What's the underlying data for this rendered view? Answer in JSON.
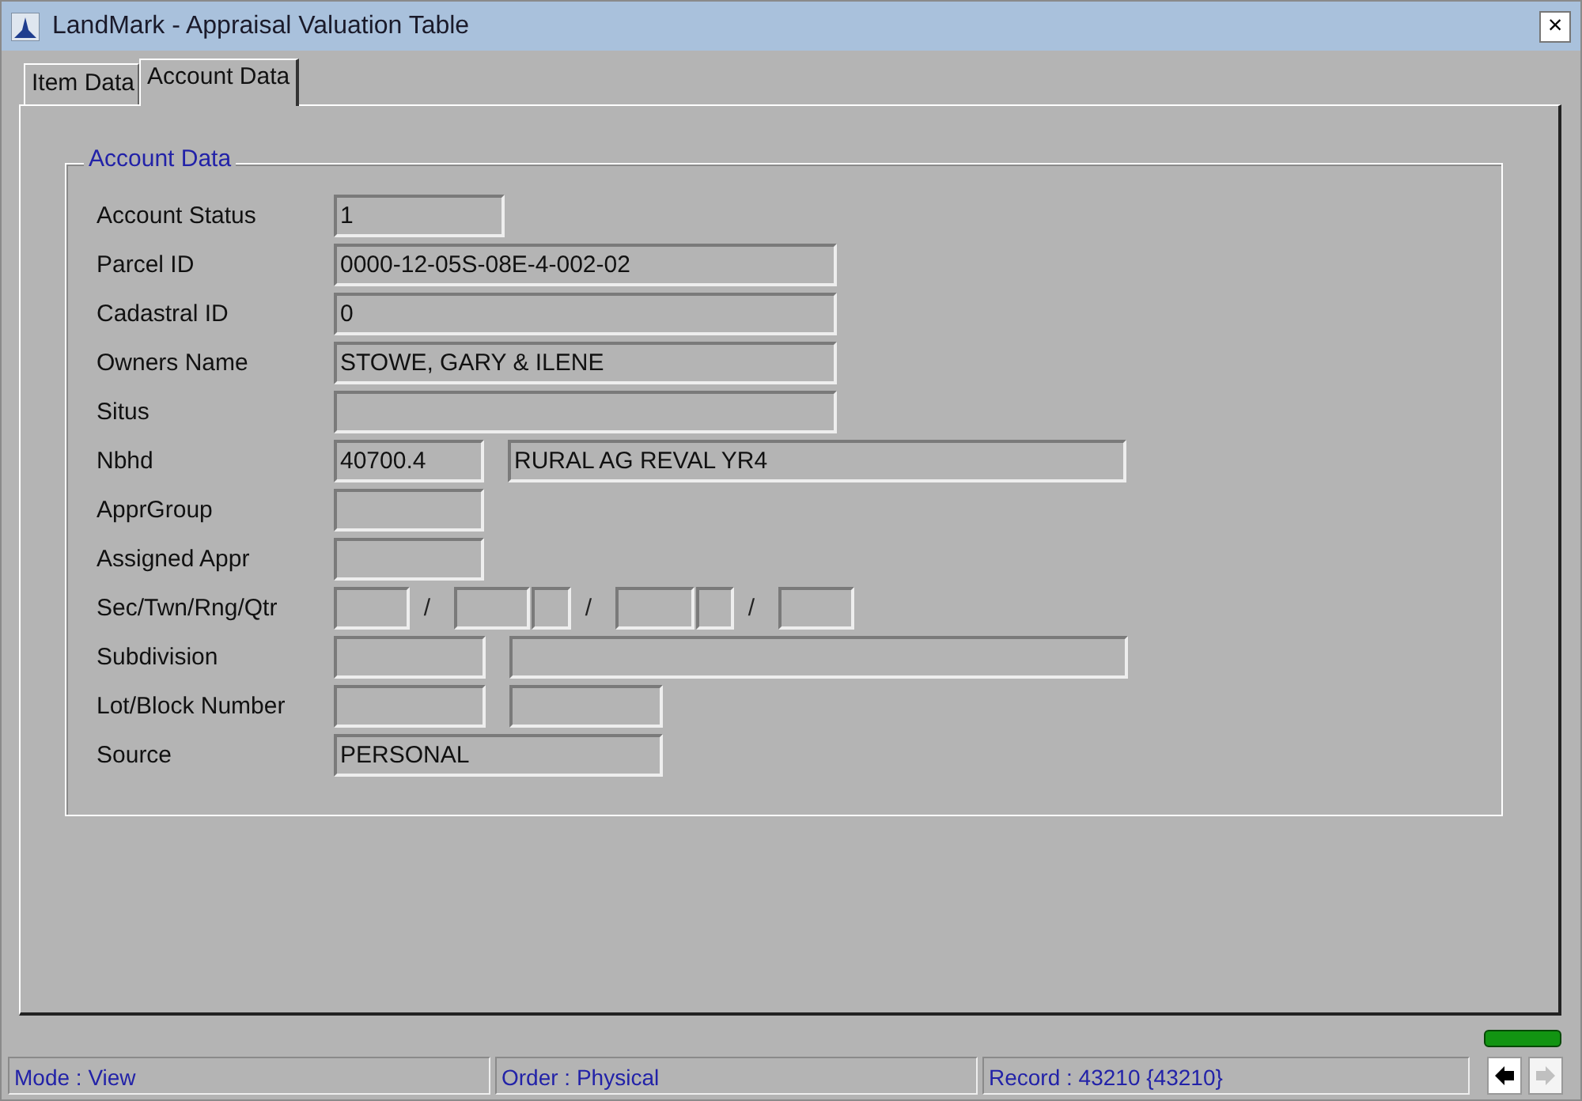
{
  "window": {
    "title": "LandMark - Appraisal Valuation Table",
    "close": "×"
  },
  "tabs": [
    {
      "label": "Item Data",
      "selected": false
    },
    {
      "label": "Account Data",
      "selected": true
    }
  ],
  "group": {
    "title": "Account Data",
    "rows": [
      {
        "label": "Account Status",
        "items": [
          {
            "kind": "field",
            "value": "1"
          }
        ]
      },
      {
        "label": "Parcel ID",
        "items": [
          {
            "kind": "field",
            "value": "0000-12-05S-08E-4-002-02"
          }
        ]
      },
      {
        "label": "Cadastral ID",
        "items": [
          {
            "kind": "field",
            "value": "0"
          }
        ]
      },
      {
        "label": "Owners Name",
        "items": [
          {
            "kind": "field",
            "value": "STOWE, GARY & ILENE"
          }
        ]
      },
      {
        "label": "Situs",
        "items": [
          {
            "kind": "field"
          }
        ]
      },
      {
        "label": "Nbhd",
        "items": [
          {
            "kind": "field",
            "value": "40700.4"
          },
          {
            "kind": "field",
            "value": "RURAL AG REVAL YR4"
          }
        ]
      },
      {
        "label": "ApprGroup",
        "items": [
          {
            "kind": "field"
          }
        ]
      },
      {
        "label": "Assigned Appr",
        "items": [
          {
            "kind": "field"
          }
        ]
      },
      {
        "label": "Sec/Twn/Rng/Qtr",
        "items": [
          {
            "kind": "field"
          },
          {
            "kind": "separator",
            "text": "/"
          },
          {
            "kind": "field"
          },
          {
            "kind": "field"
          },
          {
            "kind": "separator",
            "text": "/"
          },
          {
            "kind": "field"
          },
          {
            "kind": "field"
          },
          {
            "kind": "separator",
            "text": "/"
          },
          {
            "kind": "field"
          }
        ]
      },
      {
        "label": "Subdivision",
        "items": [
          {
            "kind": "field"
          },
          {
            "kind": "field"
          }
        ]
      },
      {
        "label": "Lot/Block Number",
        "items": [
          {
            "kind": "field"
          },
          {
            "kind": "field"
          }
        ]
      },
      {
        "label": "Source",
        "items": [
          {
            "kind": "field",
            "value": "PERSONAL"
          }
        ]
      }
    ]
  },
  "status_bar": [
    {
      "text": "Mode : View"
    },
    {
      "text": "Order : Physical"
    },
    {
      "text": "Record : 43210 {43210}"
    }
  ],
  "nav_buttons": [
    {
      "kind": "prev",
      "disabled": false
    },
    {
      "kind": "next",
      "disabled": true
    }
  ]
}
